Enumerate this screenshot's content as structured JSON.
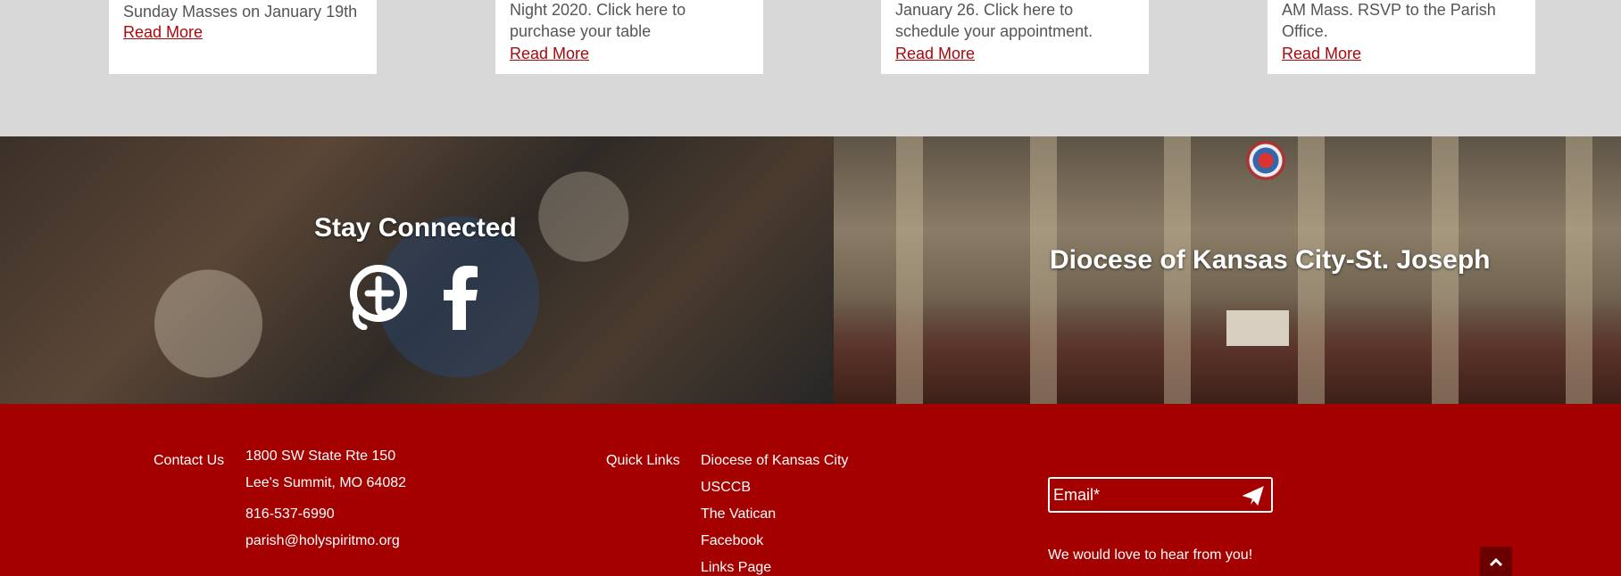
{
  "news_cards": [
    {
      "text": "Sunday Masses on January 19th",
      "link": "Read More"
    },
    {
      "text": "Night 2020. Click here to purchase your table",
      "link": "Read More"
    },
    {
      "text": "January 26. Click here to schedule your appointment.",
      "link": "Read More"
    },
    {
      "text": "AM Mass. RSVP to the Parish Office.",
      "link": "Read More"
    }
  ],
  "banners": {
    "stay_connected": {
      "title": "Stay Connected",
      "icons": [
        "flocknote-icon",
        "facebook-icon"
      ]
    },
    "diocese": {
      "title": "Diocese of Kansas City-St. Joseph"
    }
  },
  "footer": {
    "contact_label": "Contact Us",
    "address_line1": "1800 SW State Rte 150",
    "address_line2": "Lee's Summit, MO 64082",
    "phone": "816-537-6990",
    "email": "parish@holyspiritmo.org",
    "quick_links_label": "Quick Links",
    "quick_links": [
      "Diocese of Kansas City",
      "USCCB",
      "The Vatican",
      "Facebook",
      "Links Page"
    ],
    "email_placeholder": "Email*",
    "message": "We would love to hear from you!"
  },
  "colors": {
    "brand_red": "#a40000",
    "link_red": "#a8090d",
    "background_gray": "#d8d8d8"
  }
}
